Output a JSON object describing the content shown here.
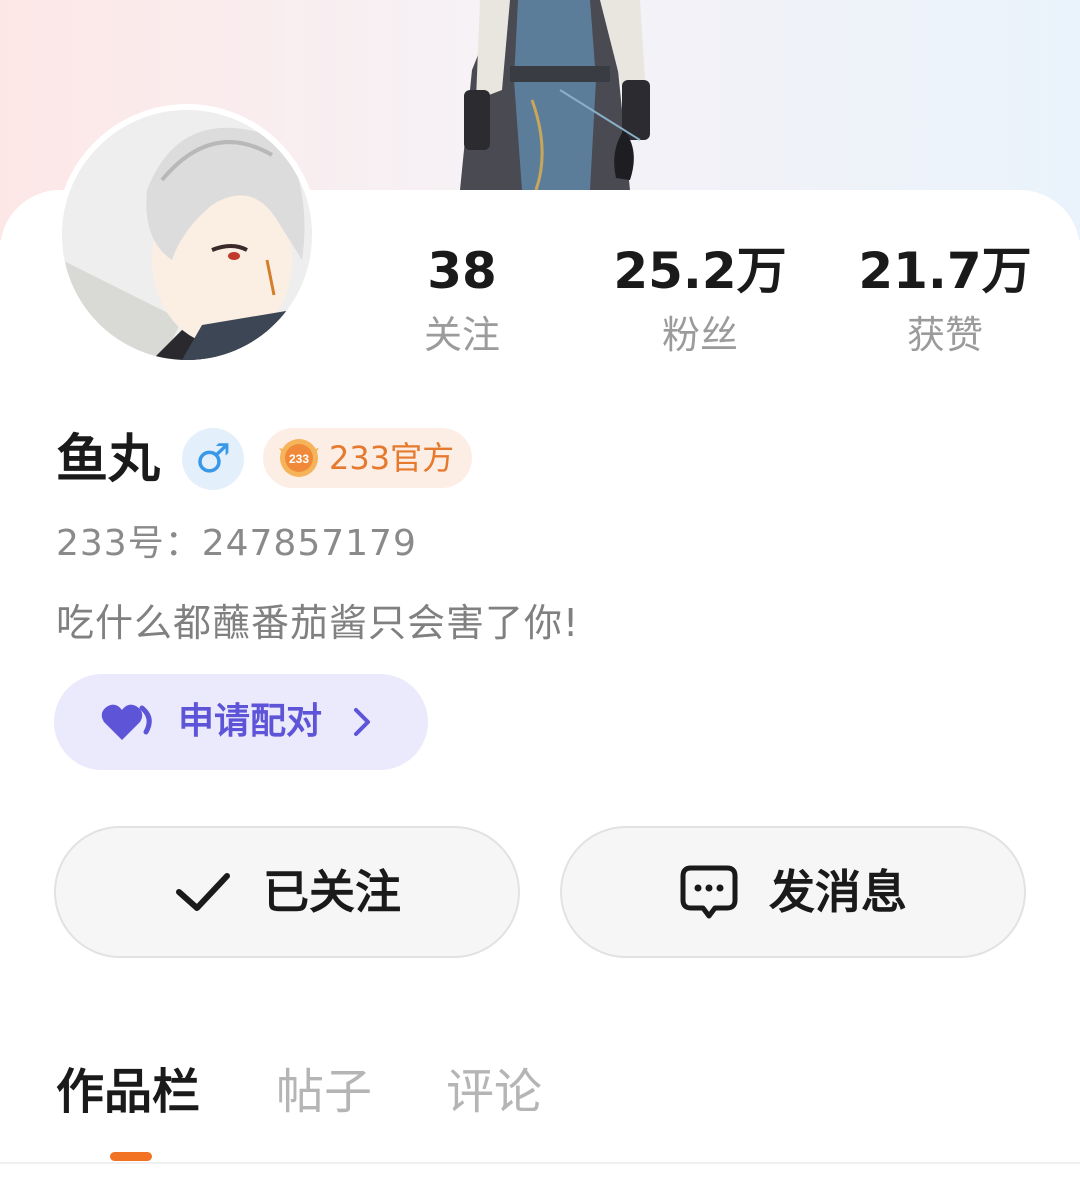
{
  "profile": {
    "name": "鱼丸",
    "gender_symbol": "♂",
    "official_badge": "233官方",
    "uid": "233号：247857179",
    "bio": "吃什么都蘸番茄酱只会害了你!"
  },
  "stats": {
    "following_value": "38",
    "following_label": "关注",
    "fans_value": "25.2万",
    "fans_label": "粉丝",
    "likes_value": "21.7万",
    "likes_label": "获赞"
  },
  "match": {
    "label": "申请配对",
    "icon": "heart-icon"
  },
  "actions": {
    "follow_label": "已关注",
    "follow_icon": "check-icon",
    "message_label": "发消息",
    "message_icon": "chat-bubble-icon"
  },
  "tabs": [
    {
      "label": "作品栏",
      "active": true
    },
    {
      "label": "帖子",
      "active": false
    },
    {
      "label": "评论",
      "active": false
    }
  ],
  "colors": {
    "accent_orange": "#f27323",
    "match_purple": "#5d54d8",
    "gender_blue": "#3a98e8",
    "badge_orange": "#e5792d"
  }
}
